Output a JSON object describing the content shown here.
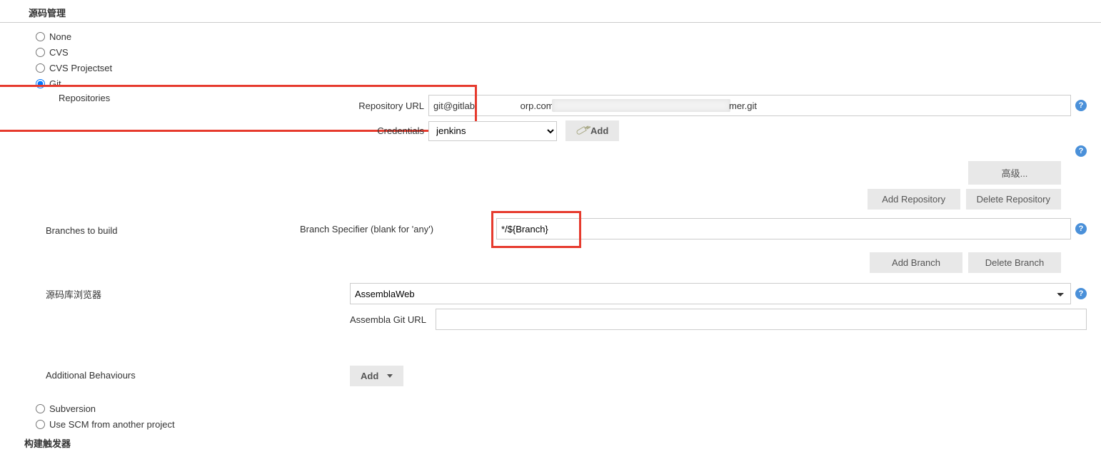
{
  "headers": {
    "scm": "源码管理",
    "triggers": "构建触发器"
  },
  "scm_options": {
    "none": "None",
    "cvs": "CVS",
    "cvs_projectset": "CVS Projectset",
    "git": "Git",
    "subversion": "Subversion",
    "use_scm_from": "Use SCM from another project"
  },
  "git": {
    "repositories_label": "Repositories",
    "repository_url_label": "Repository URL",
    "repository_url_value_pre": "git@gitlab.",
    "repository_url_value_mid": "orp.com",
    "repository_url_value_post": "mer.git",
    "credentials_label": "Credentials",
    "credentials_value": "jenkins",
    "add_button": "Add",
    "advanced_button": "高级...",
    "add_repository": "Add Repository",
    "delete_repository": "Delete Repository",
    "branches_to_build": "Branches to build",
    "branch_specifier_label": "Branch Specifier (blank for 'any')",
    "branch_value": "*/${Branch}",
    "add_branch": "Add Branch",
    "delete_branch": "Delete Branch",
    "repo_browser_label": "源码库浏览器",
    "repo_browser_value": "AssemblaWeb",
    "assembla_url_label": "Assembla Git URL",
    "assembla_url_value": "",
    "additional_behaviours": "Additional Behaviours",
    "add_behaviour": "Add"
  }
}
